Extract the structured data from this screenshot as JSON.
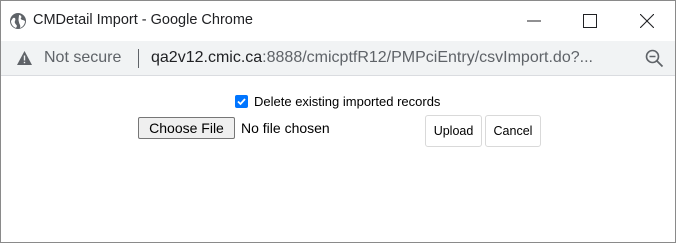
{
  "window": {
    "title": "CMDetail Import - Google Chrome"
  },
  "addressbar": {
    "security_label": "Not secure",
    "url_host": "qa2v12.cmic.ca",
    "url_rest": ":8888/cmicptfR12/PMPciEntry/csvImport.do?..."
  },
  "form": {
    "delete_checkbox_label": "Delete existing imported records",
    "delete_checkbox_checked": true,
    "choose_file_label": "Choose File",
    "file_status": "No file chosen",
    "upload_label": "Upload",
    "cancel_label": "Cancel"
  },
  "icons": {
    "page": "globe-icon",
    "minimize": "minimize-icon",
    "maximize": "maximize-icon",
    "close": "close-icon",
    "security": "warning-icon",
    "zoom": "zoom-out-icon",
    "checkbox": "checkmark-icon"
  },
  "colors": {
    "checkbox_accent": "#0075ff",
    "addressbar_bg": "#f1f3f4"
  }
}
